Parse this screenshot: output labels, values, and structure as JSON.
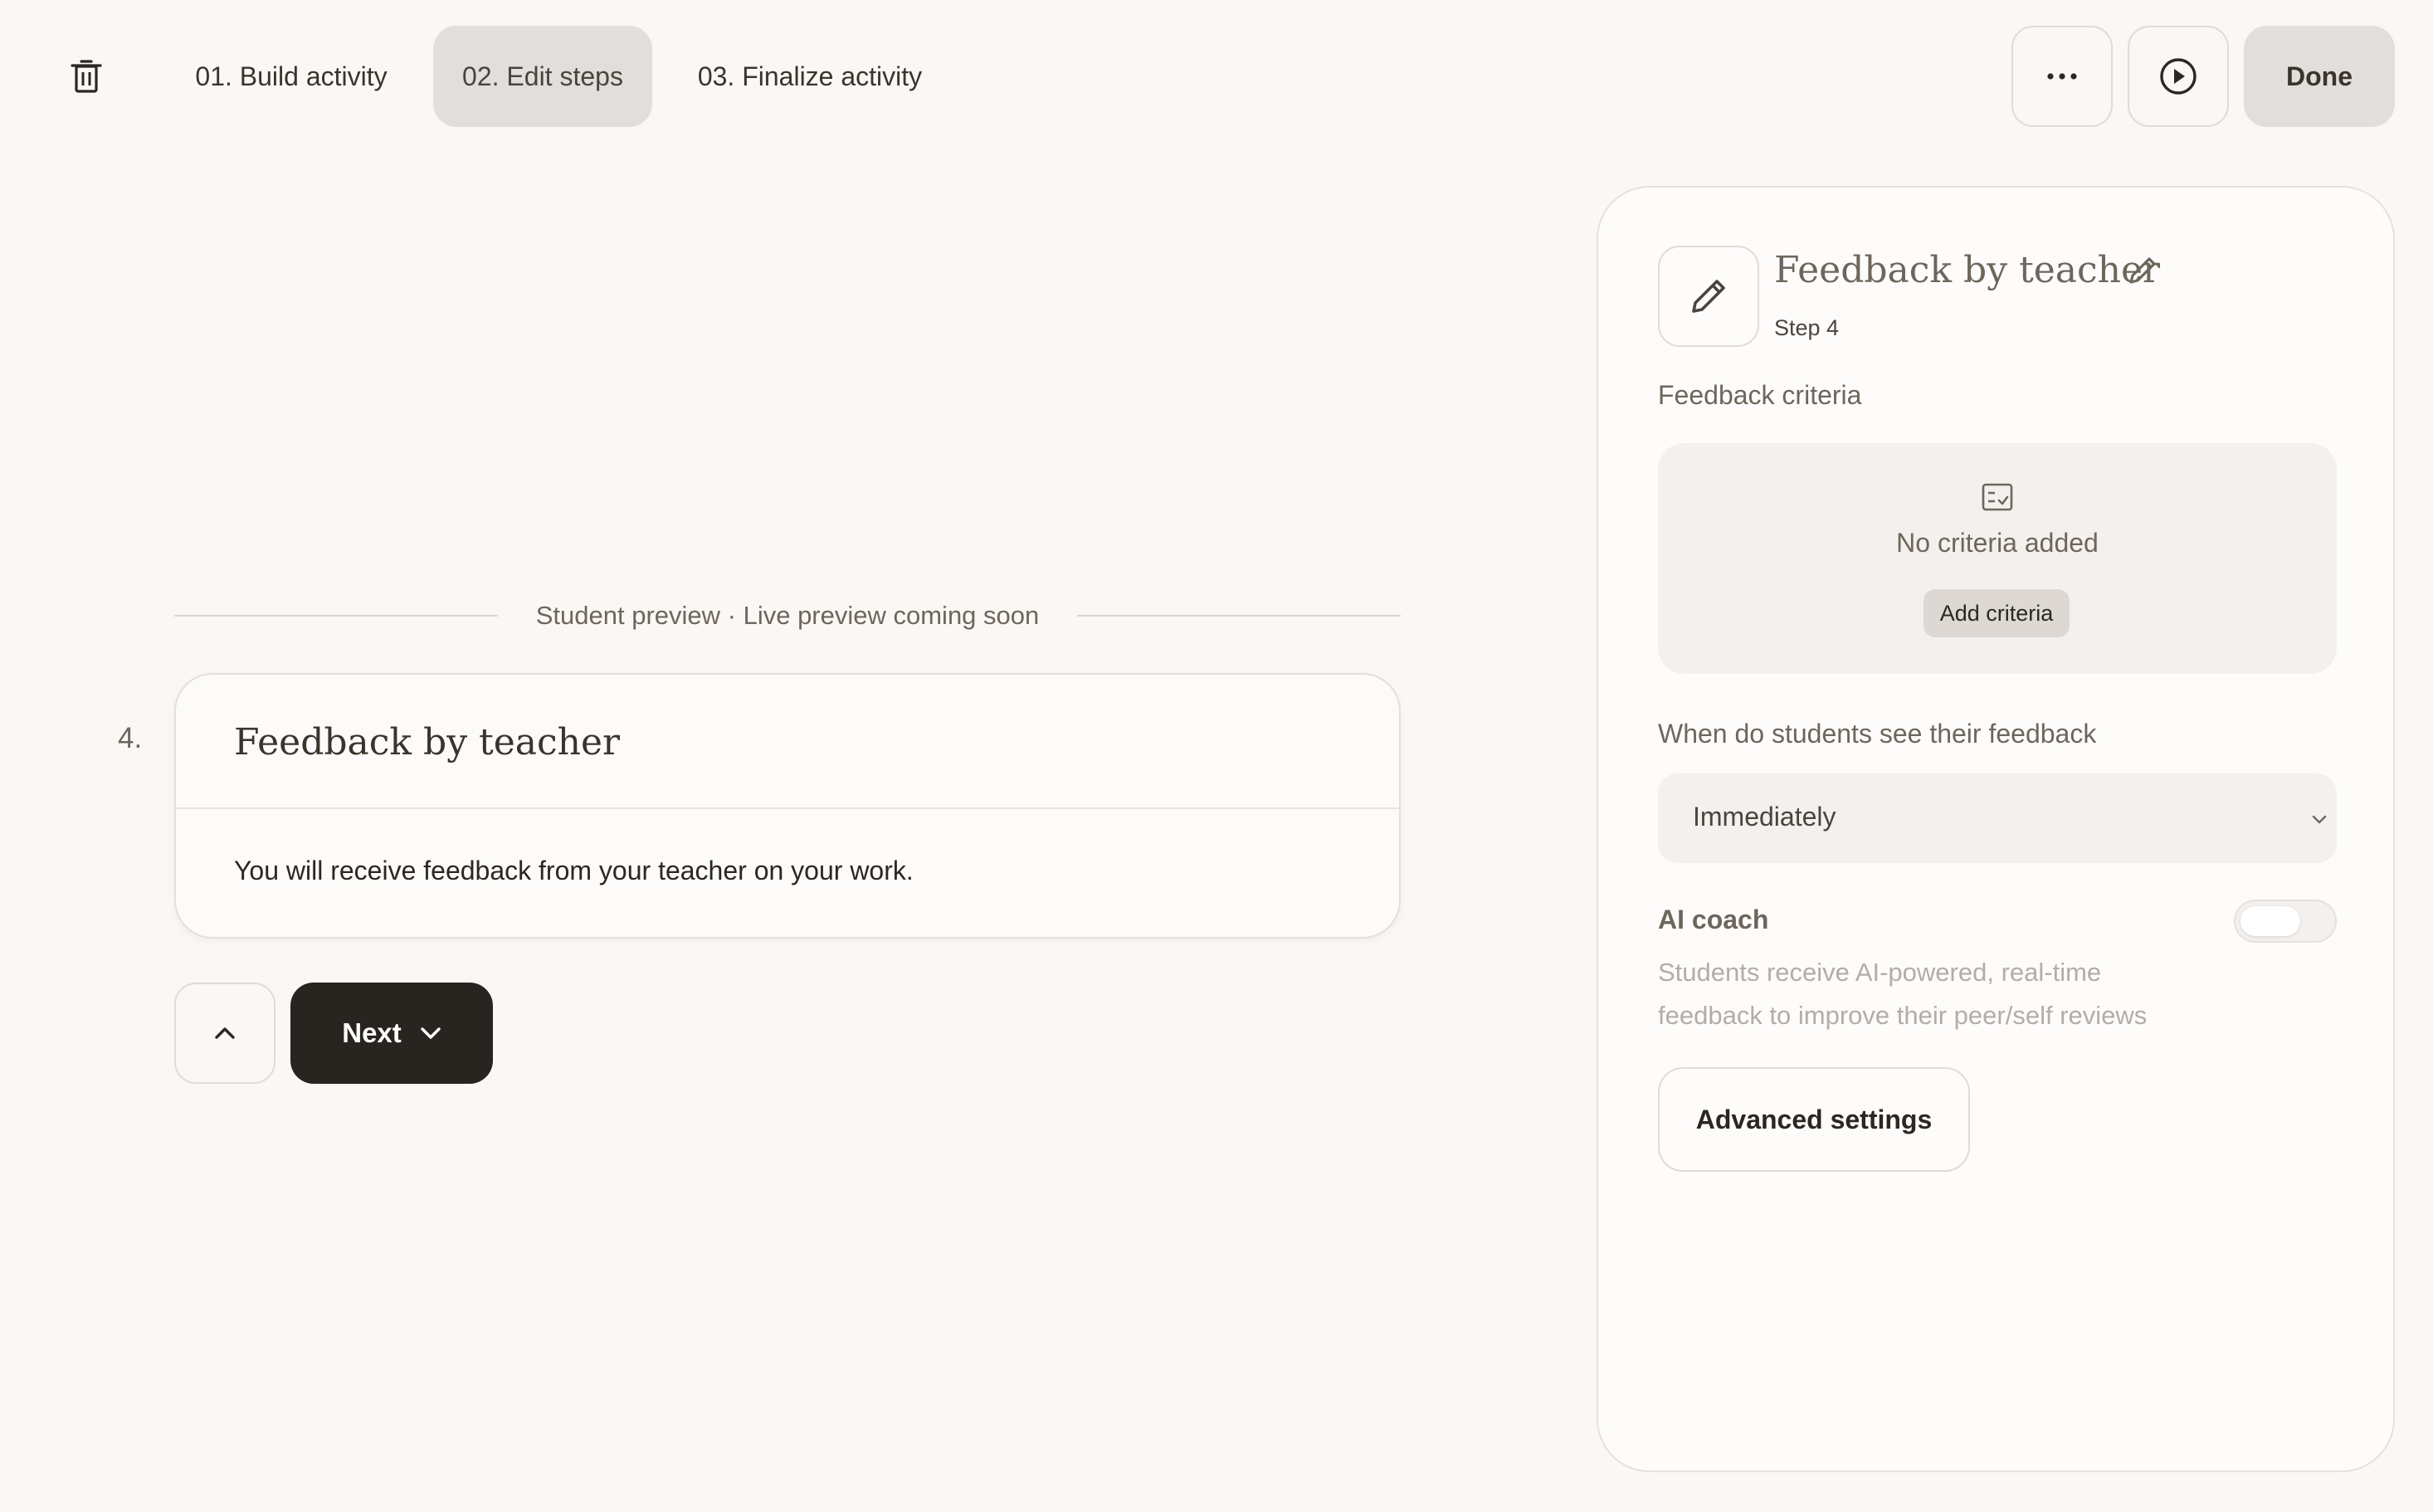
{
  "header": {
    "tabs": [
      {
        "label": "01. Build activity",
        "active": false
      },
      {
        "label": "02. Edit steps",
        "active": true
      },
      {
        "label": "03. Finalize activity",
        "active": false
      }
    ],
    "done_label": "Done",
    "icons": {
      "delete": "trash-icon",
      "more": "more-horizontal-icon",
      "preview": "play-icon"
    }
  },
  "preview": {
    "divider_label": "Student preview · Live preview coming soon",
    "step_number": "4.",
    "card_title": "Feedback by teacher",
    "card_body": "You will receive feedback from your teacher on your work.",
    "next_label": "Next"
  },
  "panel": {
    "title": "Feedback by teacher",
    "step_label": "Step 4",
    "criteria_label": "Feedback criteria",
    "criteria_empty": "No criteria added",
    "add_criteria_label": "Add criteria",
    "visibility_label": "When do students see their feedback",
    "visibility_value": "Immediately",
    "ai_coach_label": "AI coach",
    "ai_coach_enabled": false,
    "ai_coach_description": "Students receive AI-powered, real-time feedback to improve their peer/self reviews",
    "advanced_label": "Advanced settings"
  },
  "colors": {
    "background": "#faf7f4",
    "active_tab": "#e2dedb",
    "primary_button": "#282420",
    "muted_text": "#6e665c"
  }
}
